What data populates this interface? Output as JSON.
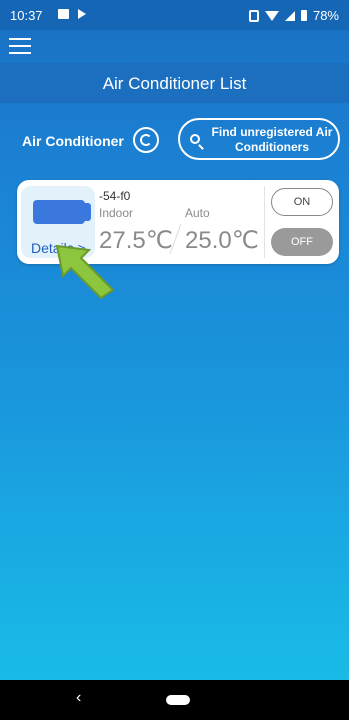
{
  "status_bar": {
    "time": "10:37",
    "battery": "78%"
  },
  "header": {
    "title": "Air Conditioner List"
  },
  "section": {
    "label": "Air Conditioner",
    "find_button": "Find unregistered Air Conditioners"
  },
  "device": {
    "id": "-54-f0",
    "indoor_label": "Indoor",
    "mode_label": "Auto",
    "indoor_temp": "27.5℃",
    "set_temp": "25.0℃",
    "details_link": "Details >",
    "on_label": "ON",
    "off_label": "OFF"
  },
  "nav": {
    "back_glyph": "‹"
  },
  "colors": {
    "primary": "#1668b8",
    "accent_unit": "#3a78de",
    "pointer": "#8cc63f"
  }
}
